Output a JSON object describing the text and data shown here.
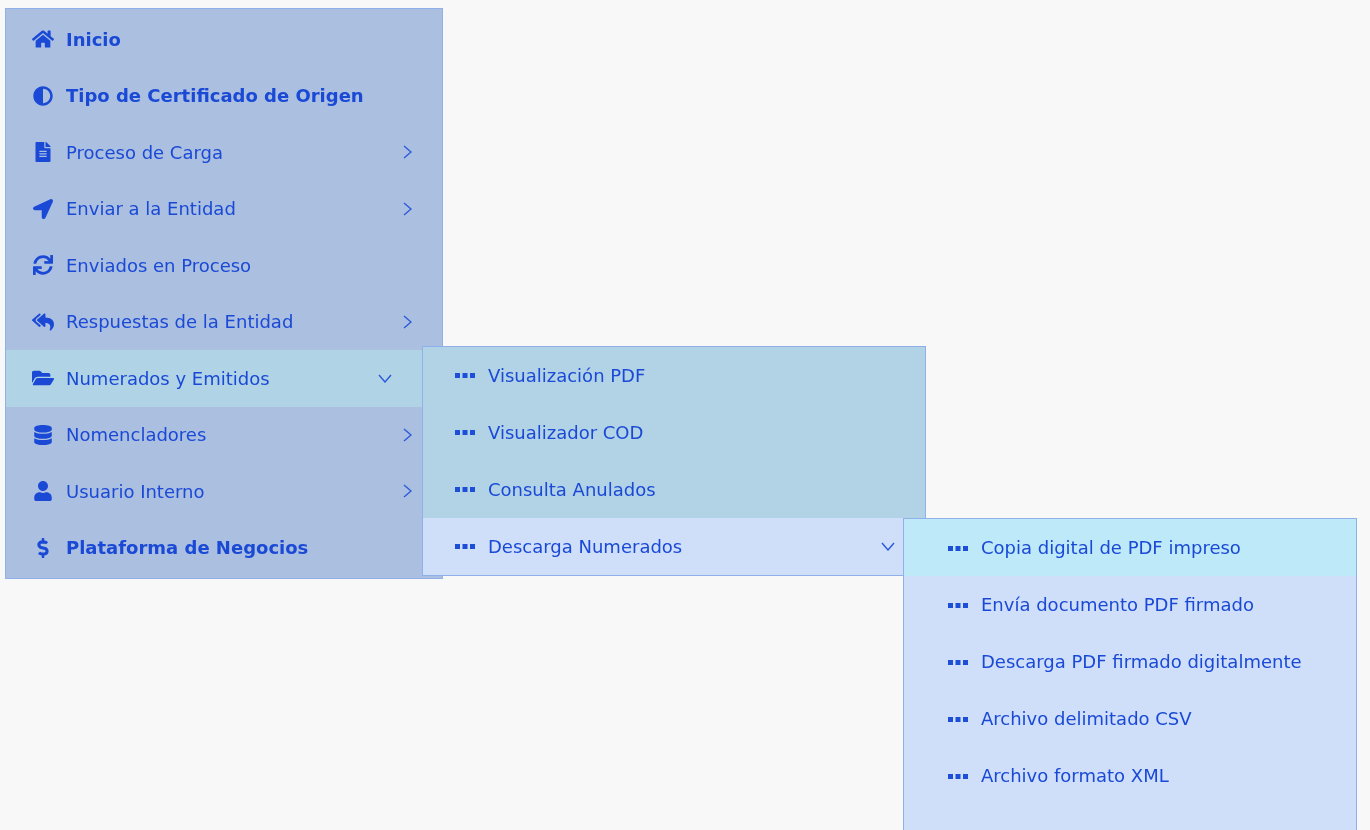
{
  "menu": {
    "items": [
      {
        "label": "Inicio",
        "kind": "heading"
      },
      {
        "label": "Tipo de Certificado de Origen",
        "kind": "heading"
      },
      {
        "label": "Proceso de Carga",
        "kind": "submenu",
        "expanded": false
      },
      {
        "label": "Enviar a la Entidad",
        "kind": "submenu",
        "expanded": false
      },
      {
        "label": "Enviados en Proceso",
        "kind": "plain"
      },
      {
        "label": "Respuestas de la Entidad",
        "kind": "submenu",
        "expanded": false
      },
      {
        "label": "Numerados y Emitidos",
        "kind": "submenu",
        "expanded": true,
        "children": [
          {
            "label": "Visualización PDF",
            "kind": "plain"
          },
          {
            "label": "Visualizador COD",
            "kind": "plain"
          },
          {
            "label": "Consulta Anulados",
            "kind": "plain"
          },
          {
            "label": "Descarga Numerados",
            "kind": "submenu",
            "expanded": true,
            "children": [
              {
                "label": "Copia digital de PDF impreso",
                "selected": true
              },
              {
                "label": "Envía documento PDF firmado",
                "selected": false
              },
              {
                "label": "Descarga PDF firmado digitalmente",
                "selected": false
              },
              {
                "label": "Archivo delimitado CSV",
                "selected": false
              },
              {
                "label": "Archivo formato XML",
                "selected": false
              }
            ]
          }
        ]
      },
      {
        "label": "Nomencladores",
        "kind": "submenu",
        "expanded": false
      },
      {
        "label": "Usuario Interno",
        "kind": "submenu",
        "expanded": false
      },
      {
        "label": "Plataforma de Negocios",
        "kind": "heading"
      }
    ]
  }
}
